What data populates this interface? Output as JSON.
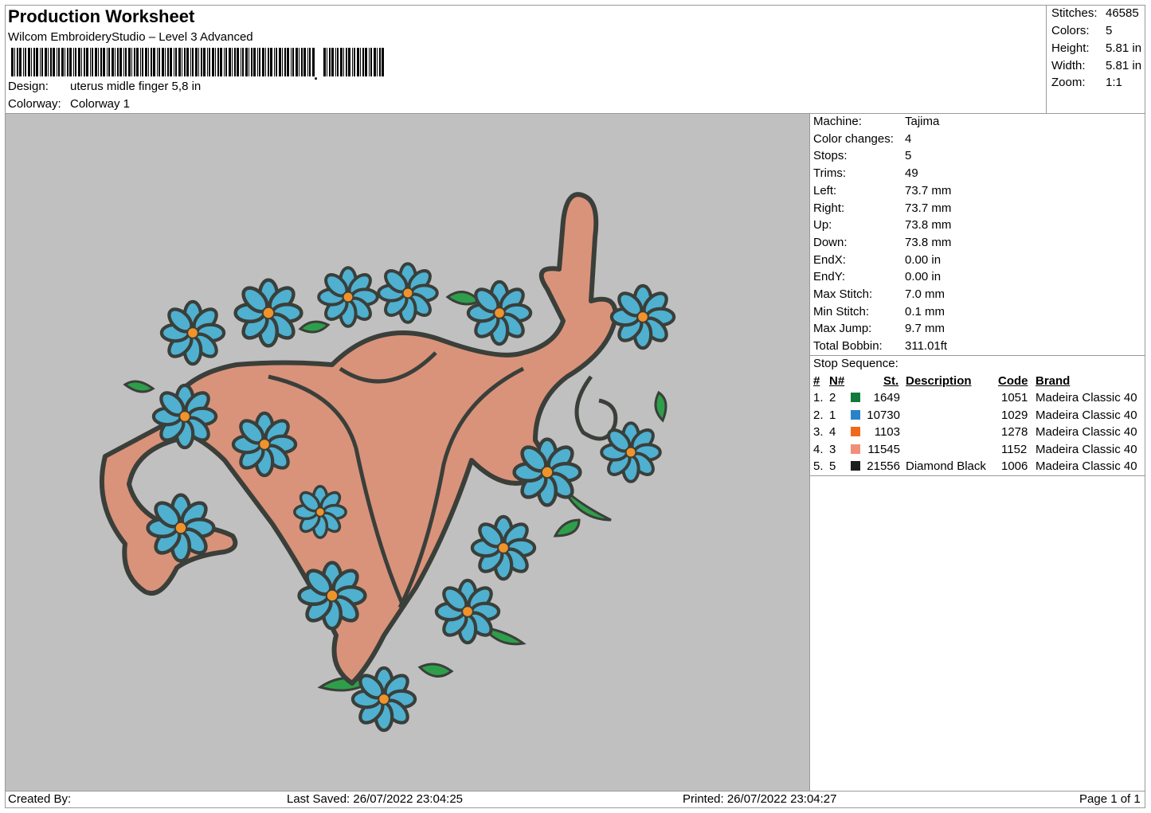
{
  "header": {
    "title": "Production Worksheet",
    "software": "Wilcom EmbroideryStudio – Level 3 Advanced",
    "design_label": "Design:",
    "design_value": "uterus midle finger 5,8 in",
    "colorway_label": "Colorway:",
    "colorway_value": "Colorway 1"
  },
  "stats": [
    {
      "label": "Stitches:",
      "value": "46585"
    },
    {
      "label": "Colors:",
      "value": "5"
    },
    {
      "label": "Height:",
      "value": "5.81 in"
    },
    {
      "label": "Width:",
      "value": "5.81 in"
    },
    {
      "label": "Zoom:",
      "value": "1:1"
    }
  ],
  "params": [
    {
      "label": "Machine:",
      "value": "Tajima"
    },
    {
      "label": "Color changes:",
      "value": "4"
    },
    {
      "label": "Stops:",
      "value": "5"
    },
    {
      "label": "Trims:",
      "value": "49"
    },
    {
      "label": "Left:",
      "value": "73.7 mm"
    },
    {
      "label": "Right:",
      "value": "73.7 mm"
    },
    {
      "label": "Up:",
      "value": "73.8 mm"
    },
    {
      "label": "Down:",
      "value": "73.8 mm"
    },
    {
      "label": "EndX:",
      "value": "0.00 in"
    },
    {
      "label": "EndY:",
      "value": "0.00 in"
    },
    {
      "label": "Max Stitch:",
      "value": "7.0 mm"
    },
    {
      "label": "Min Stitch:",
      "value": "0.1 mm"
    },
    {
      "label": "Max Jump:",
      "value": "9.7 mm"
    },
    {
      "label": "Total Bobbin:",
      "value": "311.01ft"
    }
  ],
  "stop_sequence": {
    "title": "Stop Sequence:",
    "headers": {
      "num": "#",
      "n": "N#",
      "st": "St.",
      "desc": "Description",
      "code": "Code",
      "brand": "Brand"
    },
    "rows": [
      {
        "num": "1.",
        "n": "2",
        "color": "#0f7a3c",
        "st": "1649",
        "desc": "",
        "code": "1051",
        "brand": "Madeira Classic 40"
      },
      {
        "num": "2.",
        "n": "1",
        "color": "#2a82c8",
        "st": "10730",
        "desc": "",
        "code": "1029",
        "brand": "Madeira Classic 40"
      },
      {
        "num": "3.",
        "n": "4",
        "color": "#f06a1c",
        "st": "1103",
        "desc": "",
        "code": "1278",
        "brand": "Madeira Classic 40"
      },
      {
        "num": "4.",
        "n": "3",
        "color": "#f0907a",
        "st": "11545",
        "desc": "",
        "code": "1152",
        "brand": "Madeira Classic 40"
      },
      {
        "num": "5.",
        "n": "5",
        "color": "#1c1c1c",
        "st": "21556",
        "desc": "Diamond Black",
        "code": "1006",
        "brand": "Madeira Classic 40"
      }
    ]
  },
  "footer": {
    "created_by": "Created By:",
    "last_saved": "Last Saved: 26/07/2022 23:04:25",
    "printed": "Printed: 26/07/2022 23:04:27",
    "page": "Page 1 of 1"
  },
  "design_preview": {
    "thread_colors": {
      "outline": "#3a3f3a",
      "body": "#d9937a",
      "petal": "#4fb0d0",
      "center": "#f0932a",
      "leaf": "#2e9e4a"
    }
  }
}
